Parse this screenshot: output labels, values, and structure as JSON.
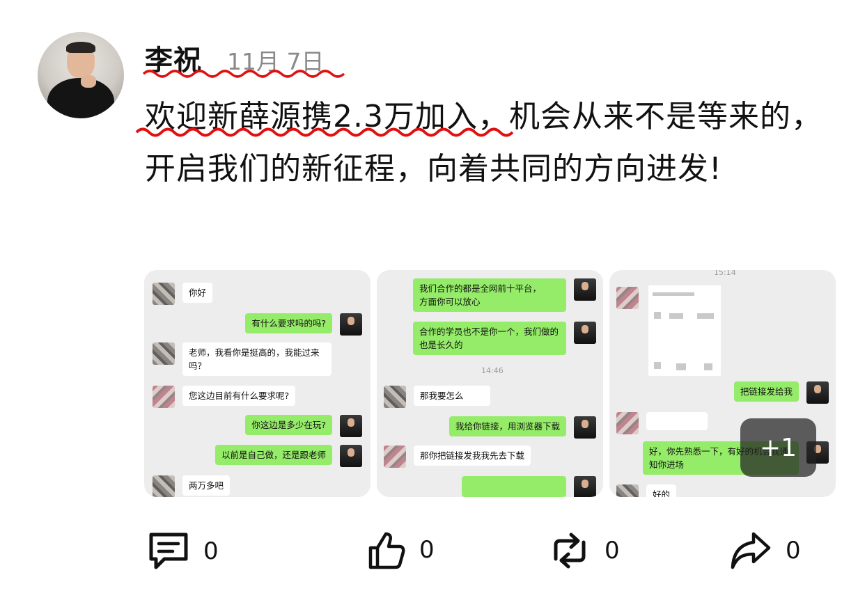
{
  "post": {
    "author": "李祝",
    "date": "11月 7日",
    "text": "欢迎新薛源携2.3万加入，机会从来不是等来的，开启我们的新征程，向着共同的方向进发!"
  },
  "gallery": {
    "more_count": "+1",
    "shot1": {
      "messages": [
        "你好",
        "有什么要求吗的吗?",
        "老师，我看你是挺高的，我能过来吗？",
        "您这边目前有什么要求呢?",
        "你这边是多少在玩?",
        "以前是自己做，还是跟老师",
        "两万多吧"
      ]
    },
    "shot2": {
      "messages": [
        "我们合作的都是全网前十平台，",
        "方面你可以放心",
        "合作的学员也不是你一个，我们做的也是长久的",
        "那我要怎么",
        "我给你链接，用浏览器下载",
        "那你把链接发我我先去下载"
      ],
      "time": "14:46"
    },
    "shot3": {
      "time": "15:14",
      "messages": [
        "把链接发给我",
        "好，你先熟悉一下，有好的机会我通知你进场",
        "好的"
      ]
    }
  },
  "actions": {
    "comment_count": "0",
    "like_count": "0",
    "repost_count": "0",
    "share_count": "0"
  }
}
